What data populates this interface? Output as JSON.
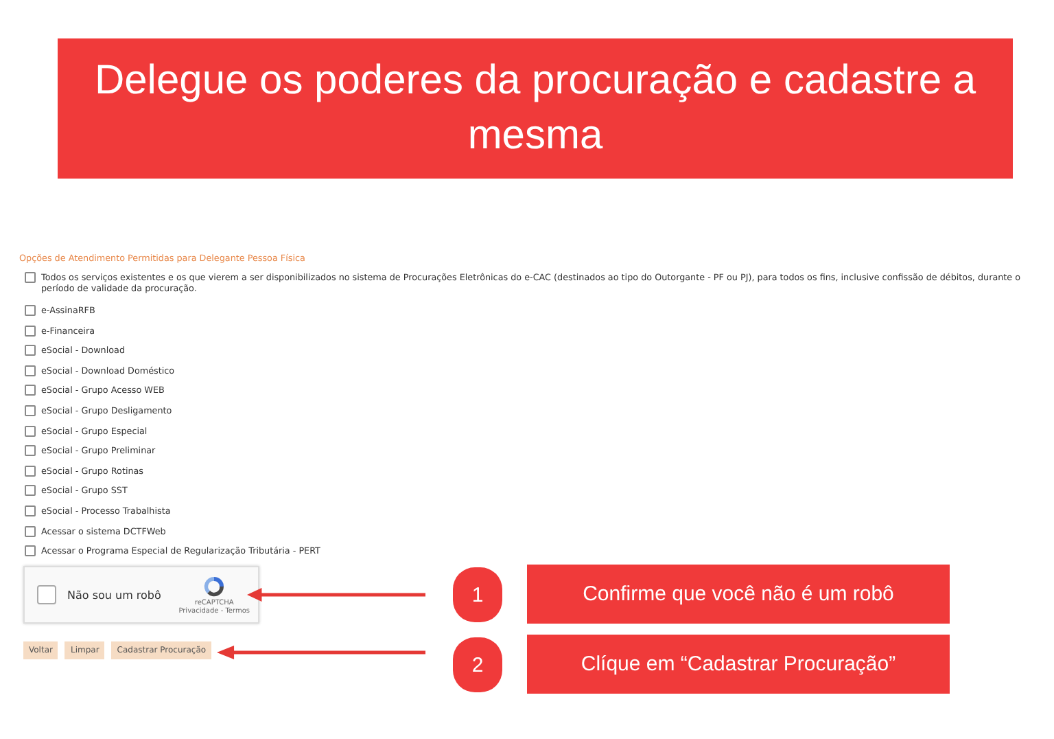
{
  "banner": {
    "title": "Delegue os poderes da procuração e cadastre a mesma"
  },
  "form": {
    "heading": "Opções de Atendimento Permitidas para Delegante Pessoa Física",
    "all_services": {
      "label": "Todos os serviços existentes e os que vierem a ser disponibilizados no sistema de Procurações Eletrônicas do e-CAC (destinados ao tipo do Outorgante - PF ou PJ), para todos os fins, inclusive confissão de débitos, durante o período de validade da procuração.",
      "checked": false
    },
    "options": [
      {
        "label": "e-AssinaRFB",
        "checked": false
      },
      {
        "label": "e-Financeira",
        "checked": false
      },
      {
        "label": "eSocial - Download",
        "checked": false
      },
      {
        "label": "eSocial - Download Doméstico",
        "checked": false
      },
      {
        "label": "eSocial - Grupo Acesso WEB",
        "checked": false
      },
      {
        "label": "eSocial - Grupo Desligamento",
        "checked": false
      },
      {
        "label": "eSocial - Grupo Especial",
        "checked": false
      },
      {
        "label": "eSocial - Grupo Preliminar",
        "checked": false
      },
      {
        "label": "eSocial - Grupo Rotinas",
        "checked": false
      },
      {
        "label": "eSocial - Grupo SST",
        "checked": false
      },
      {
        "label": "eSocial - Processo Trabalhista",
        "checked": false
      },
      {
        "label": "Acessar o sistema DCTFWeb",
        "checked": false
      },
      {
        "label": "Acessar o Programa Especial de Regularização Tributária - PERT",
        "checked": false
      }
    ],
    "captcha": {
      "label": "Não sou um robô",
      "checked": false,
      "brand": "reCAPTCHA",
      "links": "Privacidade - Termos"
    },
    "buttons": [
      "Voltar",
      "Limpar",
      "Cadastrar Procuração"
    ]
  },
  "annotations": [
    {
      "number": "1",
      "text": "Confirme que você não é um robô"
    },
    {
      "number": "2",
      "text": "Clíque em “Cadastrar Procuração”"
    }
  ]
}
